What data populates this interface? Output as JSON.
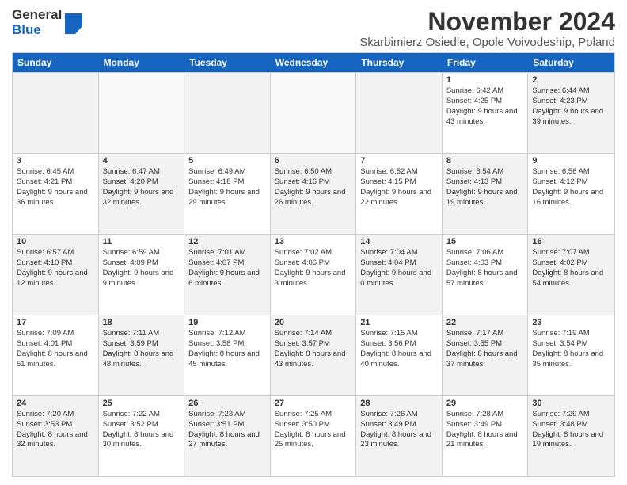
{
  "header": {
    "logo_general": "General",
    "logo_blue": "Blue",
    "title": "November 2024",
    "subtitle": "Skarbimierz Osiedle, Opole Voivodeship, Poland"
  },
  "weekdays": [
    "Sunday",
    "Monday",
    "Tuesday",
    "Wednesday",
    "Thursday",
    "Friday",
    "Saturday"
  ],
  "weeks": [
    [
      {
        "day": "",
        "info": "",
        "shaded": true
      },
      {
        "day": "",
        "info": "",
        "shaded": false
      },
      {
        "day": "",
        "info": "",
        "shaded": true
      },
      {
        "day": "",
        "info": "",
        "shaded": false
      },
      {
        "day": "",
        "info": "",
        "shaded": true
      },
      {
        "day": "1",
        "info": "Sunrise: 6:42 AM\nSunset: 4:25 PM\nDaylight: 9 hours\nand 43 minutes.",
        "shaded": false
      },
      {
        "day": "2",
        "info": "Sunrise: 6:44 AM\nSunset: 4:23 PM\nDaylight: 9 hours\nand 39 minutes.",
        "shaded": true
      }
    ],
    [
      {
        "day": "3",
        "info": "Sunrise: 6:45 AM\nSunset: 4:21 PM\nDaylight: 9 hours\nand 36 minutes.",
        "shaded": false
      },
      {
        "day": "4",
        "info": "Sunrise: 6:47 AM\nSunset: 4:20 PM\nDaylight: 9 hours\nand 32 minutes.",
        "shaded": true
      },
      {
        "day": "5",
        "info": "Sunrise: 6:49 AM\nSunset: 4:18 PM\nDaylight: 9 hours\nand 29 minutes.",
        "shaded": false
      },
      {
        "day": "6",
        "info": "Sunrise: 6:50 AM\nSunset: 4:16 PM\nDaylight: 9 hours\nand 26 minutes.",
        "shaded": true
      },
      {
        "day": "7",
        "info": "Sunrise: 6:52 AM\nSunset: 4:15 PM\nDaylight: 9 hours\nand 22 minutes.",
        "shaded": false
      },
      {
        "day": "8",
        "info": "Sunrise: 6:54 AM\nSunset: 4:13 PM\nDaylight: 9 hours\nand 19 minutes.",
        "shaded": true
      },
      {
        "day": "9",
        "info": "Sunrise: 6:56 AM\nSunset: 4:12 PM\nDaylight: 9 hours\nand 16 minutes.",
        "shaded": false
      }
    ],
    [
      {
        "day": "10",
        "info": "Sunrise: 6:57 AM\nSunset: 4:10 PM\nDaylight: 9 hours\nand 12 minutes.",
        "shaded": true
      },
      {
        "day": "11",
        "info": "Sunrise: 6:59 AM\nSunset: 4:09 PM\nDaylight: 9 hours\nand 9 minutes.",
        "shaded": false
      },
      {
        "day": "12",
        "info": "Sunrise: 7:01 AM\nSunset: 4:07 PM\nDaylight: 9 hours\nand 6 minutes.",
        "shaded": true
      },
      {
        "day": "13",
        "info": "Sunrise: 7:02 AM\nSunset: 4:06 PM\nDaylight: 9 hours\nand 3 minutes.",
        "shaded": false
      },
      {
        "day": "14",
        "info": "Sunrise: 7:04 AM\nSunset: 4:04 PM\nDaylight: 9 hours\nand 0 minutes.",
        "shaded": true
      },
      {
        "day": "15",
        "info": "Sunrise: 7:06 AM\nSunset: 4:03 PM\nDaylight: 8 hours\nand 57 minutes.",
        "shaded": false
      },
      {
        "day": "16",
        "info": "Sunrise: 7:07 AM\nSunset: 4:02 PM\nDaylight: 8 hours\nand 54 minutes.",
        "shaded": true
      }
    ],
    [
      {
        "day": "17",
        "info": "Sunrise: 7:09 AM\nSunset: 4:01 PM\nDaylight: 8 hours\nand 51 minutes.",
        "shaded": false
      },
      {
        "day": "18",
        "info": "Sunrise: 7:11 AM\nSunset: 3:59 PM\nDaylight: 8 hours\nand 48 minutes.",
        "shaded": true
      },
      {
        "day": "19",
        "info": "Sunrise: 7:12 AM\nSunset: 3:58 PM\nDaylight: 8 hours\nand 45 minutes.",
        "shaded": false
      },
      {
        "day": "20",
        "info": "Sunrise: 7:14 AM\nSunset: 3:57 PM\nDaylight: 8 hours\nand 43 minutes.",
        "shaded": true
      },
      {
        "day": "21",
        "info": "Sunrise: 7:15 AM\nSunset: 3:56 PM\nDaylight: 8 hours\nand 40 minutes.",
        "shaded": false
      },
      {
        "day": "22",
        "info": "Sunrise: 7:17 AM\nSunset: 3:55 PM\nDaylight: 8 hours\nand 37 minutes.",
        "shaded": true
      },
      {
        "day": "23",
        "info": "Sunrise: 7:19 AM\nSunset: 3:54 PM\nDaylight: 8 hours\nand 35 minutes.",
        "shaded": false
      }
    ],
    [
      {
        "day": "24",
        "info": "Sunrise: 7:20 AM\nSunset: 3:53 PM\nDaylight: 8 hours\nand 32 minutes.",
        "shaded": true
      },
      {
        "day": "25",
        "info": "Sunrise: 7:22 AM\nSunset: 3:52 PM\nDaylight: 8 hours\nand 30 minutes.",
        "shaded": false
      },
      {
        "day": "26",
        "info": "Sunrise: 7:23 AM\nSunset: 3:51 PM\nDaylight: 8 hours\nand 27 minutes.",
        "shaded": true
      },
      {
        "day": "27",
        "info": "Sunrise: 7:25 AM\nSunset: 3:50 PM\nDaylight: 8 hours\nand 25 minutes.",
        "shaded": false
      },
      {
        "day": "28",
        "info": "Sunrise: 7:26 AM\nSunset: 3:49 PM\nDaylight: 8 hours\nand 23 minutes.",
        "shaded": true
      },
      {
        "day": "29",
        "info": "Sunrise: 7:28 AM\nSunset: 3:49 PM\nDaylight: 8 hours\nand 21 minutes.",
        "shaded": false
      },
      {
        "day": "30",
        "info": "Sunrise: 7:29 AM\nSunset: 3:48 PM\nDaylight: 8 hours\nand 19 minutes.",
        "shaded": true
      }
    ]
  ]
}
